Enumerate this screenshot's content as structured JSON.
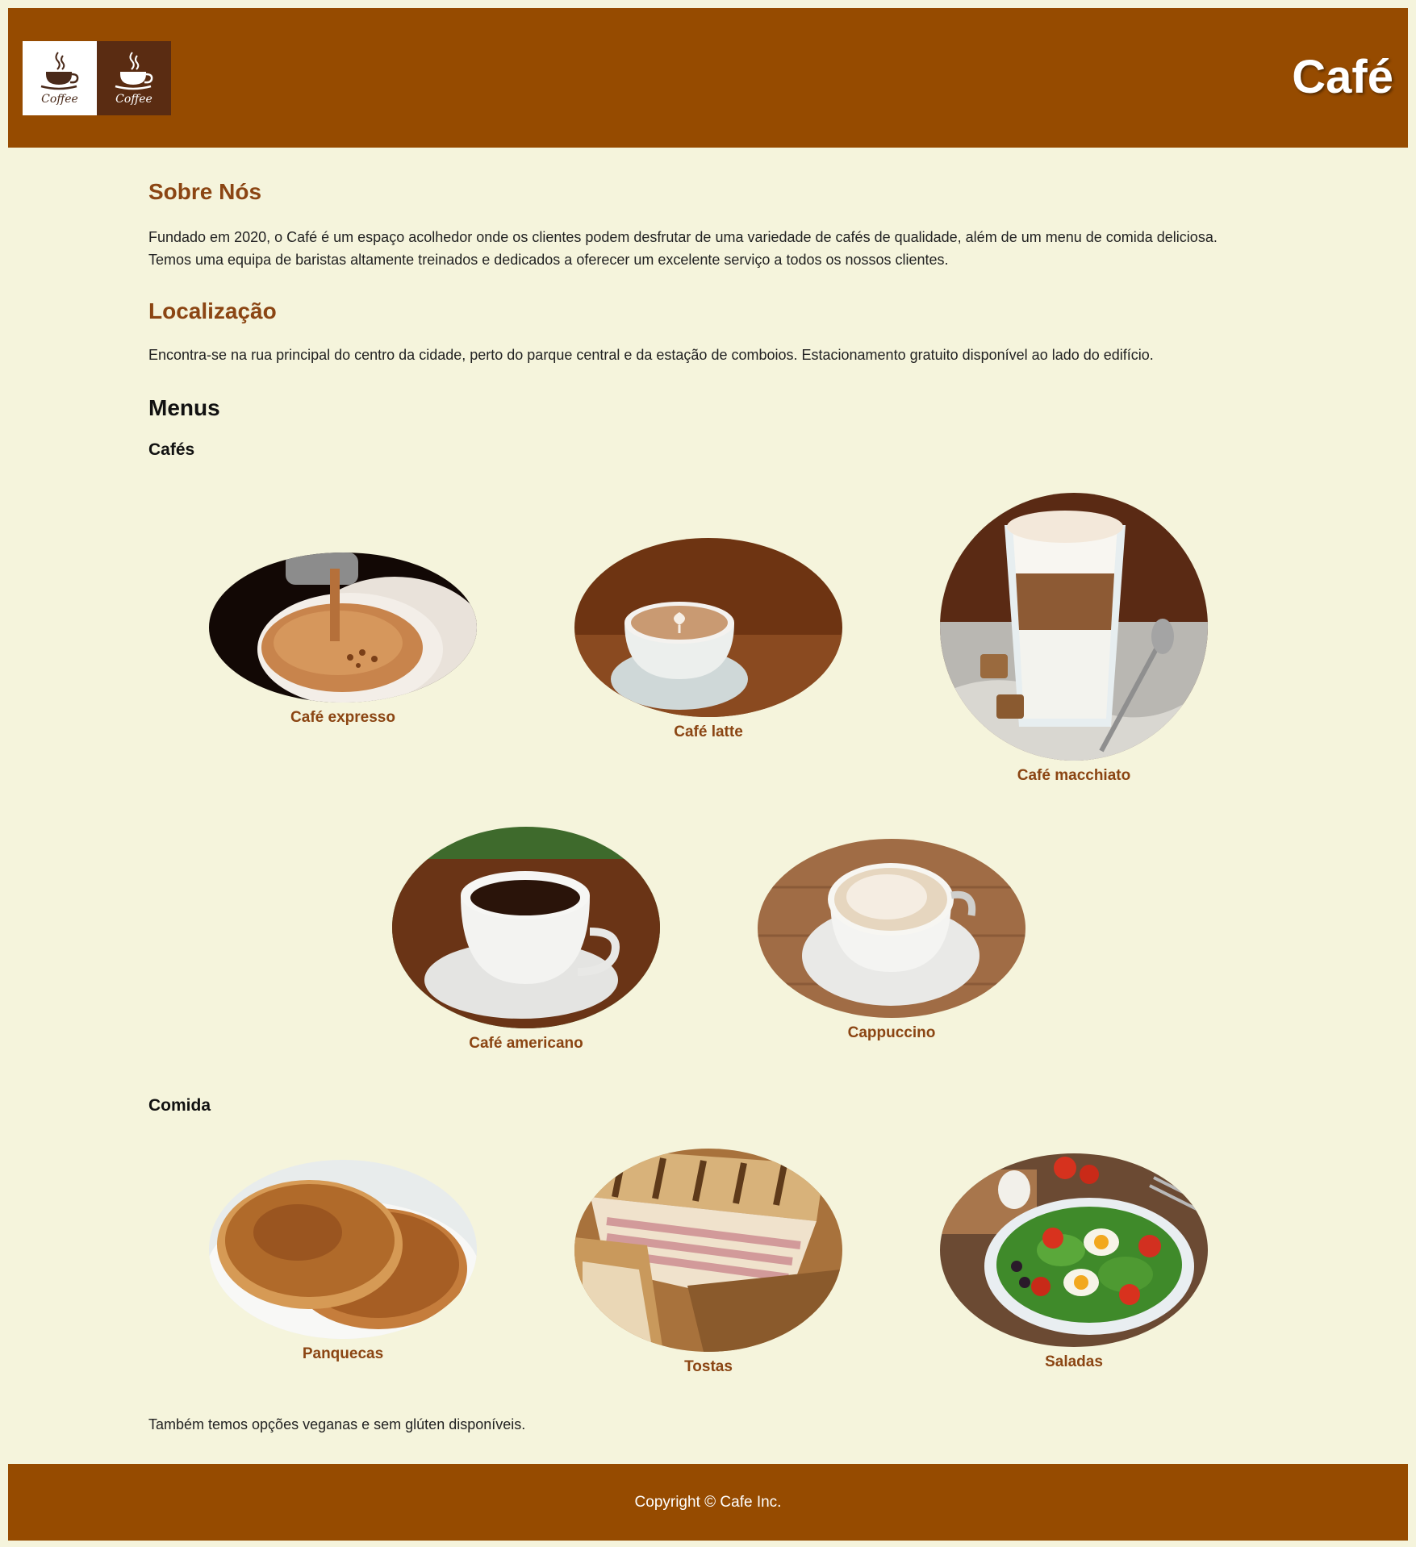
{
  "header": {
    "logo_text": "Coffee",
    "title": "Café"
  },
  "about": {
    "heading": "Sobre Nós",
    "text_line1": "Fundado em 2020, o Café é um espaço acolhedor onde os clientes podem desfrutar de uma variedade de cafés de qualidade, além de um menu de comida deliciosa.",
    "text_line2": "Temos uma equipa de baristas altamente treinados e dedicados a oferecer um excelente serviço a todos os nossos clientes."
  },
  "location": {
    "heading": "Localização",
    "text": "Encontra-se na rua principal do centro da cidade, perto do parque central e da estação de comboios. Estacionamento gratuito disponível ao lado do edifício."
  },
  "menus": {
    "heading": "Menus",
    "coffees": {
      "heading": "Cafés",
      "items": [
        {
          "label": "Café expresso"
        },
        {
          "label": "Café latte"
        },
        {
          "label": "Café macchiato"
        },
        {
          "label": "Café americano"
        },
        {
          "label": "Cappuccino"
        }
      ]
    },
    "food": {
      "heading": "Comida",
      "items": [
        {
          "label": "Panquecas"
        },
        {
          "label": "Tostas"
        },
        {
          "label": "Saladas"
        }
      ]
    },
    "note": "Também temos opções veganas e sem glúten disponíveis."
  },
  "footer": {
    "copyright": "Copyright © Cafe Inc."
  },
  "colors": {
    "header_bg": "#964b00",
    "page_bg": "#f5f4dc",
    "accent_text": "#8b4513"
  }
}
